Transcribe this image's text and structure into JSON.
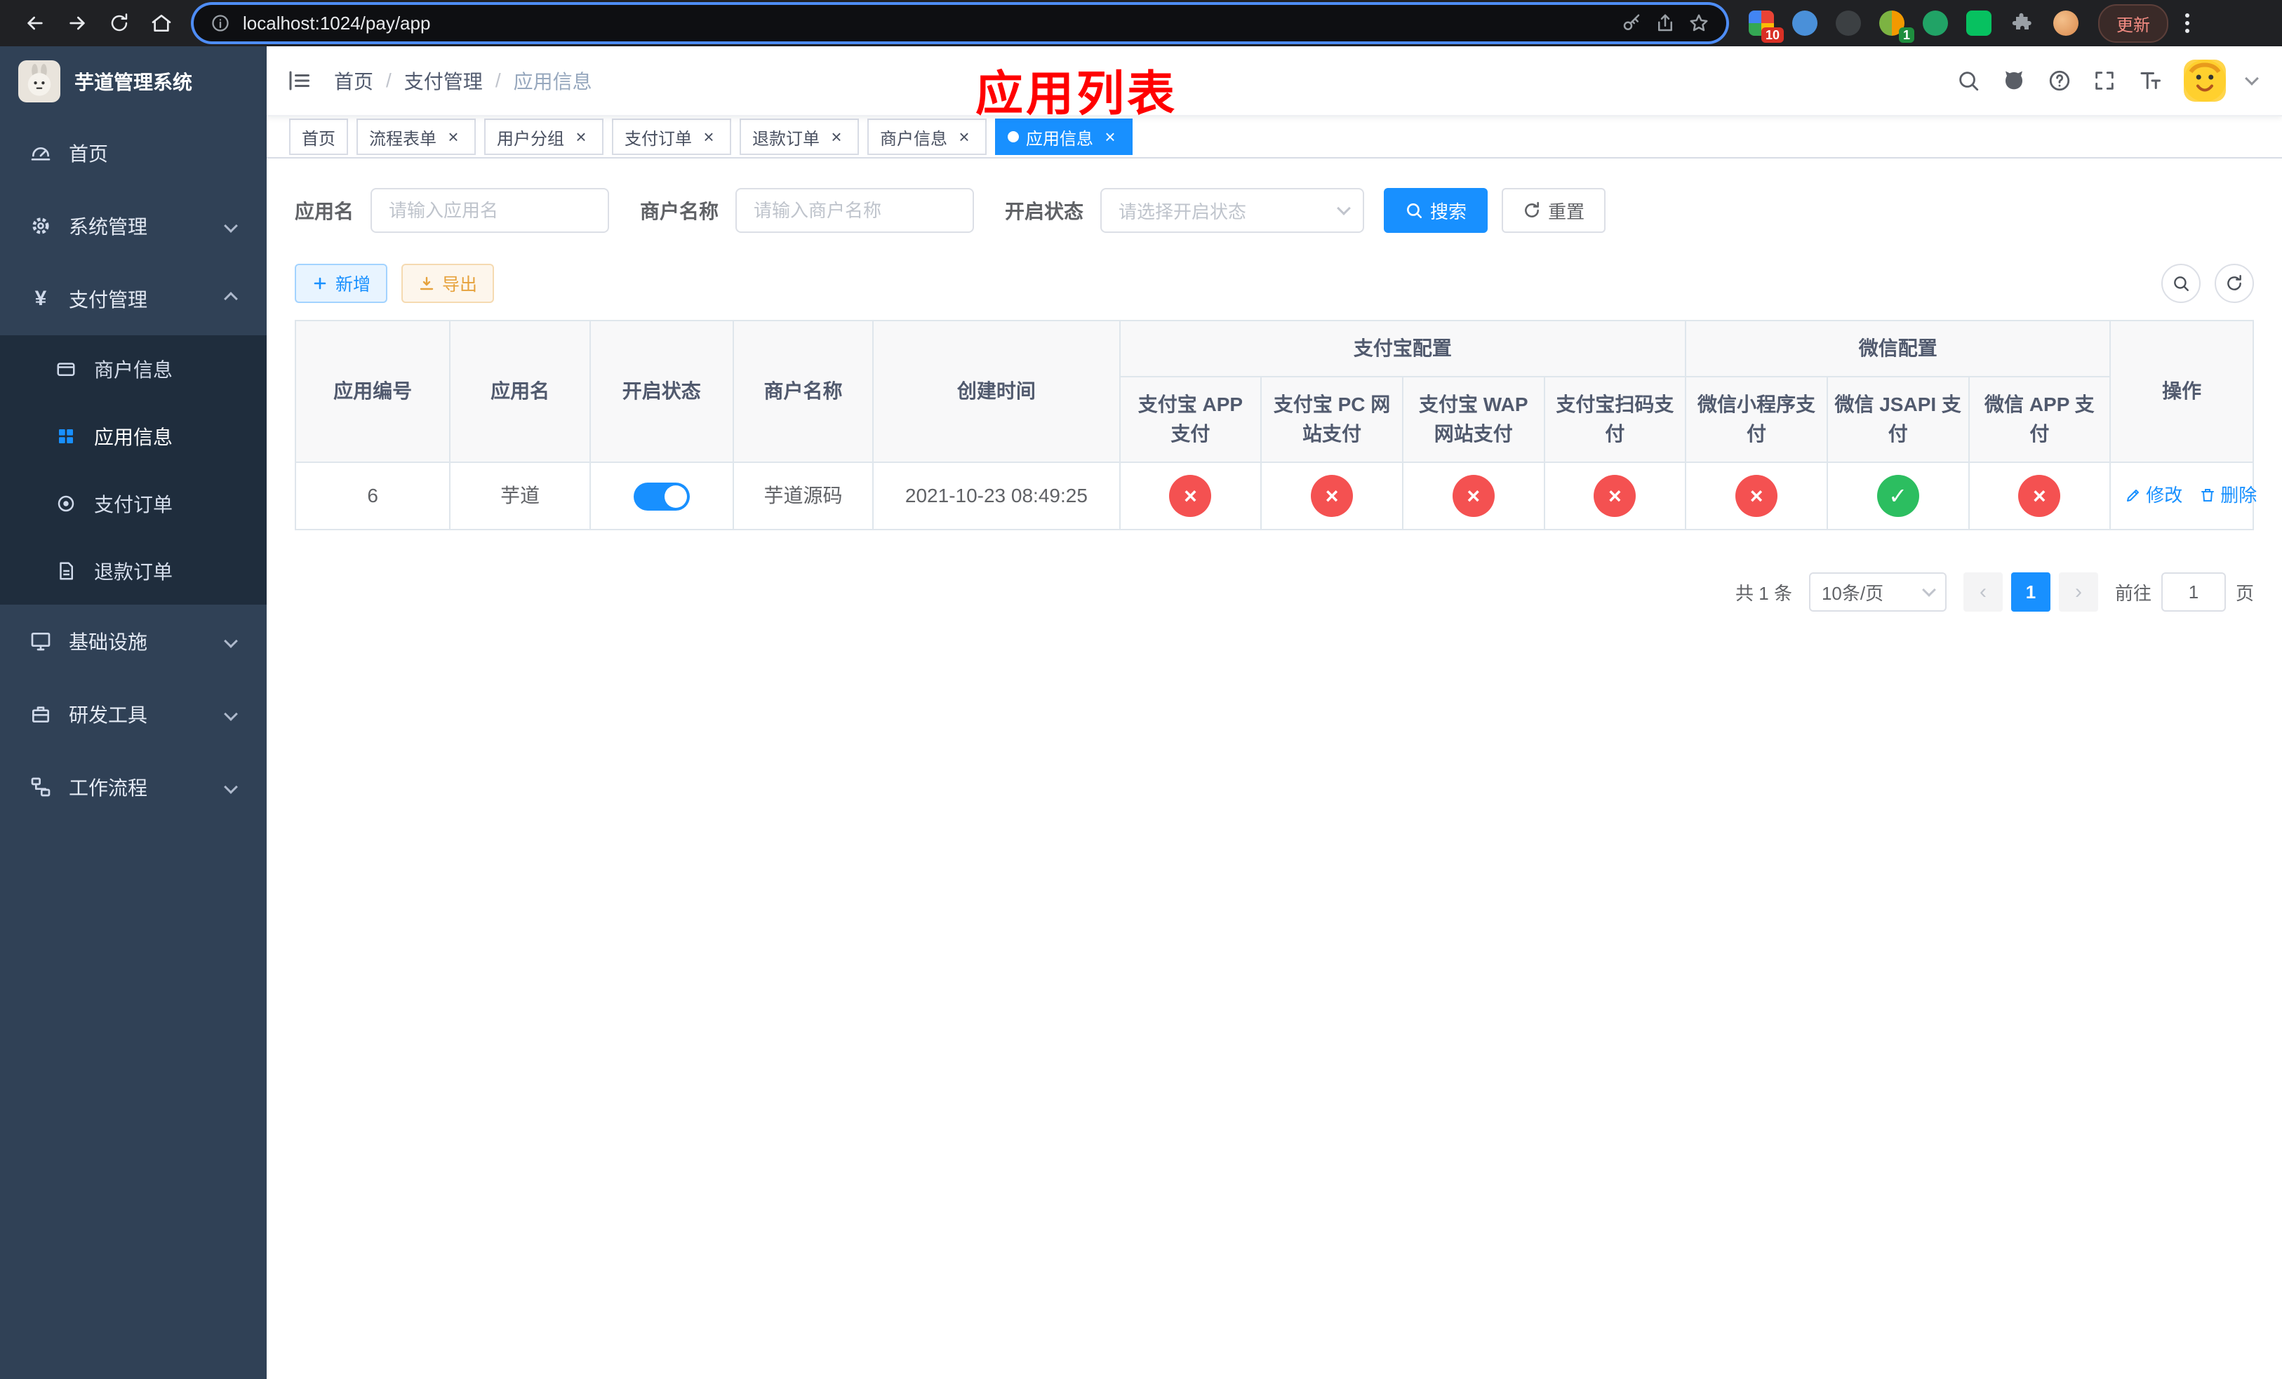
{
  "browser": {
    "url": "localhost:1024/pay/app",
    "update_label": "更新",
    "badges": {
      "extensions": "10",
      "profile": "1"
    }
  },
  "app": {
    "title": "芋道管理系统"
  },
  "sidebar": {
    "items": [
      {
        "label": "首页"
      },
      {
        "label": "系统管理"
      },
      {
        "label": "支付管理"
      },
      {
        "label": "基础设施"
      },
      {
        "label": "研发工具"
      },
      {
        "label": "工作流程"
      }
    ],
    "payment_children": [
      {
        "label": "商户信息"
      },
      {
        "label": "应用信息"
      },
      {
        "label": "支付订单"
      },
      {
        "label": "退款订单"
      }
    ]
  },
  "breadcrumb": {
    "items": [
      "首页",
      "支付管理",
      "应用信息"
    ]
  },
  "annotation": {
    "text": "应用列表"
  },
  "tabs": [
    {
      "label": "首页",
      "closable": false,
      "active": false
    },
    {
      "label": "流程表单",
      "closable": true,
      "active": false
    },
    {
      "label": "用户分组",
      "closable": true,
      "active": false
    },
    {
      "label": "支付订单",
      "closable": true,
      "active": false
    },
    {
      "label": "退款订单",
      "closable": true,
      "active": false
    },
    {
      "label": "商户信息",
      "closable": true,
      "active": false
    },
    {
      "label": "应用信息",
      "closable": true,
      "active": true
    }
  ],
  "filters": {
    "app_name": {
      "label": "应用名",
      "placeholder": "请输入应用名",
      "value": ""
    },
    "merchant_name": {
      "label": "商户名称",
      "placeholder": "请输入商户名称",
      "value": ""
    },
    "status": {
      "label": "开启状态",
      "placeholder": "请选择开启状态",
      "value": ""
    },
    "search_label": "搜索",
    "reset_label": "重置"
  },
  "toolbar": {
    "add_label": "新增",
    "export_label": "导出"
  },
  "table": {
    "columns": {
      "app_id": "应用编号",
      "app_name": "应用名",
      "status": "开启状态",
      "merchant": "商户名称",
      "created": "创建时间",
      "alipay_group": "支付宝配置",
      "wechat_group": "微信配置",
      "actions": "操作",
      "alipay_app": "支付宝 APP 支付",
      "alipay_pc": "支付宝 PC 网站支付",
      "alipay_wap": "支付宝 WAP 网站支付",
      "alipay_qr": "支付宝扫码支付",
      "wx_lite": "微信小程序支付",
      "wx_jsapi": "微信 JSAPI 支付",
      "wx_app": "微信 APP 支付"
    },
    "rows": [
      {
        "app_id": "6",
        "app_name": "芋道",
        "enabled": true,
        "merchant": "芋道源码",
        "created": "2021-10-23 08:49:25",
        "channels": {
          "alipay_app": false,
          "alipay_pc": false,
          "alipay_wap": false,
          "alipay_qr": false,
          "wx_lite": false,
          "wx_jsapi": true,
          "wx_app": false
        },
        "actions": {
          "edit": "修改",
          "delete": "删除"
        }
      }
    ]
  },
  "pagination": {
    "total_text": "共 1 条",
    "page_size": "10条/页",
    "current_page": "1",
    "goto_label": "前往",
    "goto_value": "1",
    "page_label": "页"
  },
  "colors": {
    "primary": "#1890ff",
    "success": "#2cbe60",
    "danger": "#f45151",
    "annotation": "#ff0000"
  }
}
